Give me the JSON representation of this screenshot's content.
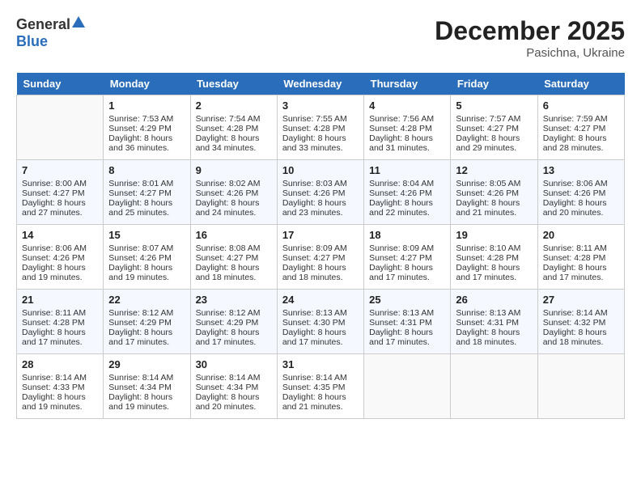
{
  "header": {
    "logo_general": "General",
    "logo_blue": "Blue",
    "month_title": "December 2025",
    "location": "Pasichna, Ukraine"
  },
  "days_of_week": [
    "Sunday",
    "Monday",
    "Tuesday",
    "Wednesday",
    "Thursday",
    "Friday",
    "Saturday"
  ],
  "weeks": [
    [
      {
        "day": "",
        "empty": true
      },
      {
        "day": "1",
        "sunrise": "Sunrise: 7:53 AM",
        "sunset": "Sunset: 4:29 PM",
        "daylight": "Daylight: 8 hours and 36 minutes."
      },
      {
        "day": "2",
        "sunrise": "Sunrise: 7:54 AM",
        "sunset": "Sunset: 4:28 PM",
        "daylight": "Daylight: 8 hours and 34 minutes."
      },
      {
        "day": "3",
        "sunrise": "Sunrise: 7:55 AM",
        "sunset": "Sunset: 4:28 PM",
        "daylight": "Daylight: 8 hours and 33 minutes."
      },
      {
        "day": "4",
        "sunrise": "Sunrise: 7:56 AM",
        "sunset": "Sunset: 4:28 PM",
        "daylight": "Daylight: 8 hours and 31 minutes."
      },
      {
        "day": "5",
        "sunrise": "Sunrise: 7:57 AM",
        "sunset": "Sunset: 4:27 PM",
        "daylight": "Daylight: 8 hours and 29 minutes."
      },
      {
        "day": "6",
        "sunrise": "Sunrise: 7:59 AM",
        "sunset": "Sunset: 4:27 PM",
        "daylight": "Daylight: 8 hours and 28 minutes."
      }
    ],
    [
      {
        "day": "7",
        "sunrise": "Sunrise: 8:00 AM",
        "sunset": "Sunset: 4:27 PM",
        "daylight": "Daylight: 8 hours and 27 minutes."
      },
      {
        "day": "8",
        "sunrise": "Sunrise: 8:01 AM",
        "sunset": "Sunset: 4:27 PM",
        "daylight": "Daylight: 8 hours and 25 minutes."
      },
      {
        "day": "9",
        "sunrise": "Sunrise: 8:02 AM",
        "sunset": "Sunset: 4:26 PM",
        "daylight": "Daylight: 8 hours and 24 minutes."
      },
      {
        "day": "10",
        "sunrise": "Sunrise: 8:03 AM",
        "sunset": "Sunset: 4:26 PM",
        "daylight": "Daylight: 8 hours and 23 minutes."
      },
      {
        "day": "11",
        "sunrise": "Sunrise: 8:04 AM",
        "sunset": "Sunset: 4:26 PM",
        "daylight": "Daylight: 8 hours and 22 minutes."
      },
      {
        "day": "12",
        "sunrise": "Sunrise: 8:05 AM",
        "sunset": "Sunset: 4:26 PM",
        "daylight": "Daylight: 8 hours and 21 minutes."
      },
      {
        "day": "13",
        "sunrise": "Sunrise: 8:06 AM",
        "sunset": "Sunset: 4:26 PM",
        "daylight": "Daylight: 8 hours and 20 minutes."
      }
    ],
    [
      {
        "day": "14",
        "sunrise": "Sunrise: 8:06 AM",
        "sunset": "Sunset: 4:26 PM",
        "daylight": "Daylight: 8 hours and 19 minutes."
      },
      {
        "day": "15",
        "sunrise": "Sunrise: 8:07 AM",
        "sunset": "Sunset: 4:26 PM",
        "daylight": "Daylight: 8 hours and 19 minutes."
      },
      {
        "day": "16",
        "sunrise": "Sunrise: 8:08 AM",
        "sunset": "Sunset: 4:27 PM",
        "daylight": "Daylight: 8 hours and 18 minutes."
      },
      {
        "day": "17",
        "sunrise": "Sunrise: 8:09 AM",
        "sunset": "Sunset: 4:27 PM",
        "daylight": "Daylight: 8 hours and 18 minutes."
      },
      {
        "day": "18",
        "sunrise": "Sunrise: 8:09 AM",
        "sunset": "Sunset: 4:27 PM",
        "daylight": "Daylight: 8 hours and 17 minutes."
      },
      {
        "day": "19",
        "sunrise": "Sunrise: 8:10 AM",
        "sunset": "Sunset: 4:28 PM",
        "daylight": "Daylight: 8 hours and 17 minutes."
      },
      {
        "day": "20",
        "sunrise": "Sunrise: 8:11 AM",
        "sunset": "Sunset: 4:28 PM",
        "daylight": "Daylight: 8 hours and 17 minutes."
      }
    ],
    [
      {
        "day": "21",
        "sunrise": "Sunrise: 8:11 AM",
        "sunset": "Sunset: 4:28 PM",
        "daylight": "Daylight: 8 hours and 17 minutes."
      },
      {
        "day": "22",
        "sunrise": "Sunrise: 8:12 AM",
        "sunset": "Sunset: 4:29 PM",
        "daylight": "Daylight: 8 hours and 17 minutes."
      },
      {
        "day": "23",
        "sunrise": "Sunrise: 8:12 AM",
        "sunset": "Sunset: 4:29 PM",
        "daylight": "Daylight: 8 hours and 17 minutes."
      },
      {
        "day": "24",
        "sunrise": "Sunrise: 8:13 AM",
        "sunset": "Sunset: 4:30 PM",
        "daylight": "Daylight: 8 hours and 17 minutes."
      },
      {
        "day": "25",
        "sunrise": "Sunrise: 8:13 AM",
        "sunset": "Sunset: 4:31 PM",
        "daylight": "Daylight: 8 hours and 17 minutes."
      },
      {
        "day": "26",
        "sunrise": "Sunrise: 8:13 AM",
        "sunset": "Sunset: 4:31 PM",
        "daylight": "Daylight: 8 hours and 18 minutes."
      },
      {
        "day": "27",
        "sunrise": "Sunrise: 8:14 AM",
        "sunset": "Sunset: 4:32 PM",
        "daylight": "Daylight: 8 hours and 18 minutes."
      }
    ],
    [
      {
        "day": "28",
        "sunrise": "Sunrise: 8:14 AM",
        "sunset": "Sunset: 4:33 PM",
        "daylight": "Daylight: 8 hours and 19 minutes."
      },
      {
        "day": "29",
        "sunrise": "Sunrise: 8:14 AM",
        "sunset": "Sunset: 4:34 PM",
        "daylight": "Daylight: 8 hours and 19 minutes."
      },
      {
        "day": "30",
        "sunrise": "Sunrise: 8:14 AM",
        "sunset": "Sunset: 4:34 PM",
        "daylight": "Daylight: 8 hours and 20 minutes."
      },
      {
        "day": "31",
        "sunrise": "Sunrise: 8:14 AM",
        "sunset": "Sunset: 4:35 PM",
        "daylight": "Daylight: 8 hours and 21 minutes."
      },
      {
        "day": "",
        "empty": true
      },
      {
        "day": "",
        "empty": true
      },
      {
        "day": "",
        "empty": true
      }
    ]
  ]
}
